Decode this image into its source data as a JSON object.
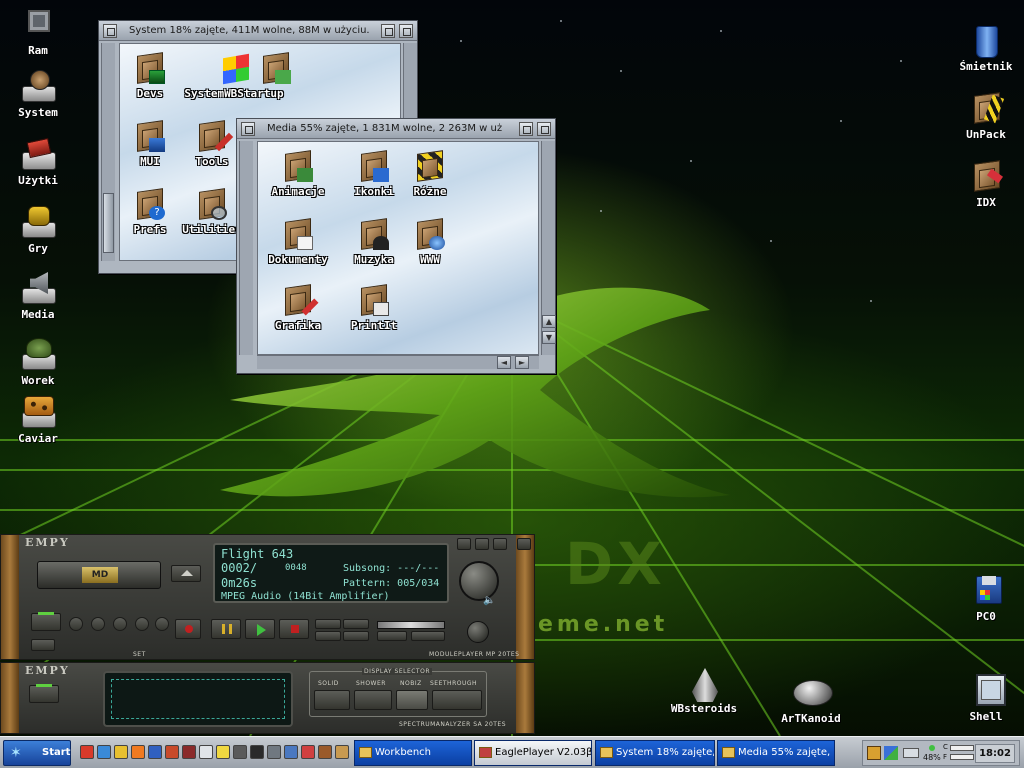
{
  "desktop": {
    "left_icons": [
      {
        "label": "Ram",
        "icon": "chip-icon"
      },
      {
        "label": "System",
        "icon": "harddisk-icon"
      },
      {
        "label": "Użytki",
        "icon": "toolbox-icon"
      },
      {
        "label": "Gry",
        "icon": "gamepad-icon"
      },
      {
        "label": "Media",
        "icon": "speaker-icon"
      },
      {
        "label": "Worek",
        "icon": "sack-icon"
      },
      {
        "label": "Caviar",
        "icon": "leopard-drive-icon"
      }
    ],
    "right_icons": [
      {
        "label": "Śmietnik",
        "icon": "trashcan-icon"
      },
      {
        "label": "UnPack",
        "icon": "unpack-icon"
      },
      {
        "label": "IDX",
        "icon": "idx-icon"
      },
      {
        "label": "PC0",
        "icon": "floppy-icon"
      },
      {
        "label": "Shell",
        "icon": "shell-window-icon"
      }
    ],
    "bottom_icons": [
      {
        "label": "WBsteroids",
        "icon": "spaceship-icon"
      },
      {
        "label": "ArTKanoid",
        "icon": "ufo-icon"
      }
    ],
    "wallpaper_text": {
      "brand": "DX",
      "url": "eme.net"
    }
  },
  "windows": {
    "system": {
      "title": "System   18% zajęte, 411M wolne, 88M w użyciu.",
      "icons": [
        {
          "label": "Devs",
          "badge": "devs"
        },
        {
          "label": "SystemWBStartup",
          "badge": "system"
        },
        {
          "label": "MUI",
          "badge": "mui"
        },
        {
          "label": "Tools",
          "badge": "tools"
        },
        {
          "label": "Prefs",
          "badge": "prefs"
        },
        {
          "label": "Utilities",
          "badge": "utilities"
        }
      ],
      "icon_extra": "WBStartup"
    },
    "media": {
      "title": "Media   55% zajęte, 1 831M wolne, 2 263M w uż",
      "icons": [
        {
          "label": "Animacje"
        },
        {
          "label": "Ikonki"
        },
        {
          "label": "Różne"
        },
        {
          "label": "Dokumenty"
        },
        {
          "label": "Muzyka"
        },
        {
          "label": "WWW"
        },
        {
          "label": "Grafika"
        },
        {
          "label": "PrintIt"
        }
      ]
    }
  },
  "player": {
    "brand": "EMPY",
    "deck_label": "MD",
    "track_title": "Flight 643",
    "position": "0002/",
    "position_total": "0048",
    "time": "0m26s",
    "subsong": "Subsong: ---/---",
    "pattern": "Pattern: 005/034",
    "format": "MPEG Audio (14Bit Amplifier)",
    "footer": "MODULEPLAYER MP 20TES",
    "set_label": "SET"
  },
  "analyzer": {
    "brand": "EMPY",
    "display_selector": "DISPLAY SELECTOR",
    "modes": [
      "SOLID",
      "SHOWER",
      "NOBIZ",
      "SEETHROUGH"
    ],
    "footer": "SPECTRUMANALYZER SA 20TES"
  },
  "taskbar": {
    "start_label": "Start",
    "tasks": [
      {
        "label": "Workbench"
      },
      {
        "label": "EaglePlayer V2.03β"
      },
      {
        "label": "System  18% zajęte,"
      },
      {
        "label": "Media  55% zajęte,"
      }
    ],
    "tray": {
      "cpu": "48%",
      "c_label": "C",
      "f_label": "F"
    },
    "clock": "18:02"
  },
  "colors": {
    "taskbar_task": "#1d64d8",
    "wallpaper_green": "#8bd12a",
    "lcd_text": "#8ee0d0"
  }
}
